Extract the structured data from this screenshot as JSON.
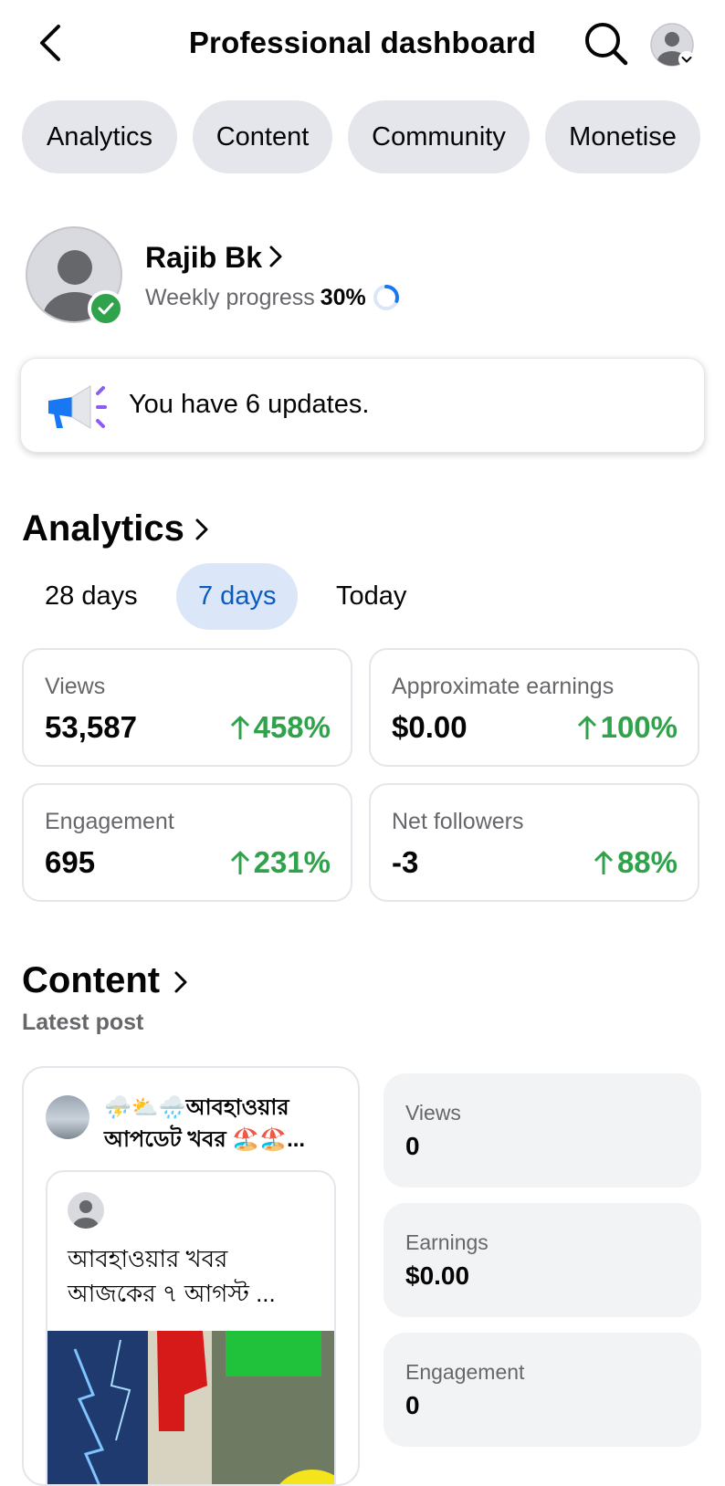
{
  "header": {
    "title": "Professional dashboard"
  },
  "tabs": [
    {
      "label": "Analytics"
    },
    {
      "label": "Content"
    },
    {
      "label": "Community"
    },
    {
      "label": "Monetise"
    }
  ],
  "profile": {
    "name": "Rajib Bk",
    "progress_label": "Weekly progress",
    "progress_value": "30%",
    "progress_fraction": 0.3
  },
  "updates": {
    "text": "You have 6 updates."
  },
  "analytics": {
    "title": "Analytics",
    "periods": [
      "28 days",
      "7 days",
      "Today"
    ],
    "active_period": "7 days",
    "stats": [
      {
        "label": "Views",
        "value": "53,587",
        "change": "458%"
      },
      {
        "label": "Approximate earnings",
        "value": "$0.00",
        "change": "100%"
      },
      {
        "label": "Engagement",
        "value": "695",
        "change": "231%"
      },
      {
        "label": "Net followers",
        "value": "-3",
        "change": "88%"
      }
    ]
  },
  "content": {
    "title": "Content",
    "latest_label": "Latest post",
    "post": {
      "title": "⛈️⛅🌧️আবহাওয়ার আপডেট খবর 🏖️🏖️...",
      "shared_text": "আবহাওয়ার খবর আজকের ৭ আগস্ট ..."
    },
    "post_stats": [
      {
        "label": "Views",
        "value": "0"
      },
      {
        "label": "Earnings",
        "value": "$0.00"
      },
      {
        "label": "Engagement",
        "value": "0"
      }
    ]
  },
  "colors": {
    "positive": "#31a24c",
    "accent": "#0a5bbd",
    "chip_bg": "#e4e6eb",
    "active_chip_bg": "#dbe7f8"
  },
  "icons": {
    "back": "back-arrow-icon",
    "search": "search-icon",
    "account": "account-avatar-icon",
    "verified": "verified-check-icon",
    "megaphone": "megaphone-icon",
    "up_arrow": "up-arrow-icon"
  }
}
